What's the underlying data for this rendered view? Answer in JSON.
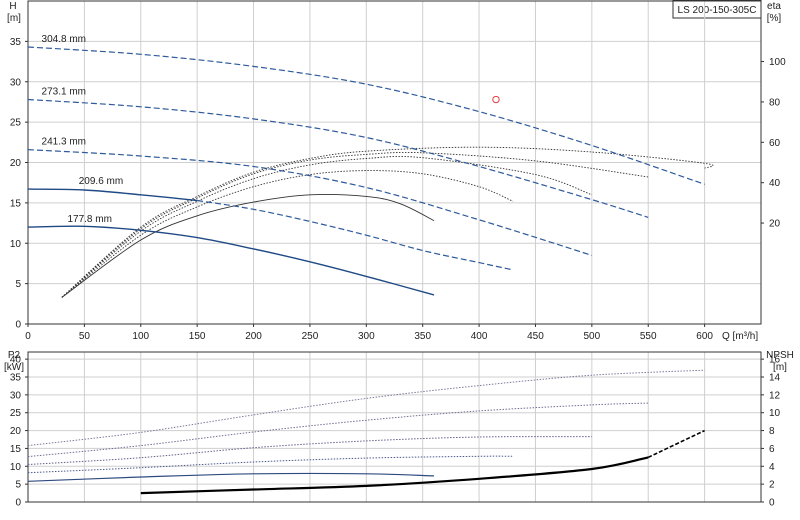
{
  "title_box": "LS 200-150-305C",
  "colors": {
    "head_curve": "#2e5a9c",
    "head_solid": "#1f4a85",
    "eta_curve": "#333333",
    "npsh_curve": "#000000",
    "duty_point": "#e0403f",
    "grid": "#cfcfcf"
  },
  "chart_data": [
    {
      "type": "line",
      "panel": "head",
      "xlabel": "Q [m³/h]",
      "ylabel_left": "H\n[m]",
      "ylabel_right": "eta\n[%]",
      "xlim": [
        0,
        650
      ],
      "ylim": [
        0,
        40
      ],
      "ylim_right": [
        -30,
        130
      ],
      "x_ticks": [
        0,
        50,
        100,
        150,
        200,
        250,
        300,
        350,
        400,
        450,
        500,
        550,
        600
      ],
      "y_ticks": [
        0,
        5,
        10,
        15,
        20,
        25,
        30,
        35
      ],
      "y_ticks_right": [
        20,
        40,
        60,
        80,
        100
      ],
      "grid": true,
      "head_series": [
        {
          "name": "304.8 mm",
          "style": "dashed",
          "points": [
            [
              0,
              34.3
            ],
            [
              100,
              33.4
            ],
            [
              200,
              31.9
            ],
            [
              300,
              29.7
            ],
            [
              400,
              26.3
            ],
            [
              500,
              22.1
            ],
            [
              600,
              17.3
            ]
          ]
        },
        {
          "name": "273.1 mm",
          "style": "dashed",
          "points": [
            [
              0,
              27.8
            ],
            [
              100,
              26.9
            ],
            [
              200,
              25.4
            ],
            [
              300,
              23.1
            ],
            [
              400,
              19.5
            ],
            [
              500,
              15.4
            ],
            [
              550,
              13.2
            ]
          ]
        },
        {
          "name": "241.3 mm",
          "style": "dashed",
          "points": [
            [
              0,
              21.6
            ],
            [
              100,
              20.8
            ],
            [
              200,
              19.5
            ],
            [
              300,
              16.9
            ],
            [
              400,
              12.9
            ],
            [
              500,
              8.5
            ]
          ]
        },
        {
          "name": "209.6 mm",
          "style": "mixed",
          "points": [
            [
              0,
              16.7
            ],
            [
              50,
              16.6
            ],
            [
              100,
              16.0
            ],
            [
              150,
              15.3
            ],
            [
              200,
              14.2
            ],
            [
              250,
              12.7
            ],
            [
              300,
              11.0
            ],
            [
              350,
              9.1
            ],
            [
              400,
              7.6
            ],
            [
              430,
              6.7
            ]
          ]
        },
        {
          "name": "177.8 mm",
          "style": "solid",
          "points": [
            [
              0,
              12.0
            ],
            [
              50,
              12.1
            ],
            [
              100,
              11.6
            ],
            [
              150,
              10.7
            ],
            [
              200,
              9.3
            ],
            [
              250,
              7.7
            ],
            [
              300,
              5.9
            ],
            [
              360,
              3.6
            ]
          ]
        }
      ],
      "eta_series": [
        {
          "style": "dotted",
          "points": [
            [
              30,
              3.3
            ],
            [
              100,
              12.0
            ],
            [
              150,
              15.8
            ],
            [
              200,
              18.8
            ],
            [
              250,
              20.5
            ],
            [
              300,
              21.4
            ],
            [
              400,
              21.9
            ],
            [
              500,
              21.3
            ],
            [
              600,
              19.9
            ],
            [
              600,
              19.3
            ]
          ]
        },
        {
          "style": "dotted",
          "points": [
            [
              30,
              3.3
            ],
            [
              100,
              11.8
            ],
            [
              150,
              15.6
            ],
            [
              200,
              18.6
            ],
            [
              250,
              20.3
            ],
            [
              300,
              21.0
            ],
            [
              350,
              21.2
            ],
            [
              450,
              20.2
            ],
            [
              550,
              18.2
            ]
          ]
        },
        {
          "style": "dotted",
          "points": [
            [
              30,
              3.3
            ],
            [
              100,
              11.5
            ],
            [
              150,
              15.2
            ],
            [
              200,
              18.0
            ],
            [
              250,
              19.7
            ],
            [
              300,
              20.5
            ],
            [
              350,
              20.6
            ],
            [
              450,
              18.5
            ],
            [
              500,
              16.0
            ]
          ]
        },
        {
          "style": "dotted",
          "points": [
            [
              30,
              3.3
            ],
            [
              100,
              11.0
            ],
            [
              150,
              14.5
            ],
            [
              200,
              17.0
            ],
            [
              250,
              18.5
            ],
            [
              300,
              19.0
            ],
            [
              350,
              18.6
            ],
            [
              400,
              17.0
            ],
            [
              430,
              15.2
            ]
          ]
        },
        {
          "style": "solid",
          "points": [
            [
              30,
              3.3
            ],
            [
              100,
              10.4
            ],
            [
              150,
              13.4
            ],
            [
              200,
              15.1
            ],
            [
              250,
              16.0
            ],
            [
              300,
              15.8
            ],
            [
              330,
              14.9
            ],
            [
              360,
              12.8
            ]
          ]
        }
      ],
      "duty_point": {
        "q": 415,
        "h": 27.8
      }
    },
    {
      "type": "line",
      "panel": "power",
      "xlim": [
        0,
        650
      ],
      "ylabel_left": "P2\n[kW]",
      "ylabel_right": "NPSH\n[m]",
      "ylim": [
        0,
        42
      ],
      "ylim_right": [
        0,
        16.8
      ],
      "y_ticks": [
        0,
        5,
        10,
        15,
        20,
        25,
        30,
        35,
        40
      ],
      "y_ticks_right": [
        0,
        2,
        4,
        6,
        8,
        10,
        12,
        14,
        16
      ],
      "grid": true,
      "power_series": [
        {
          "style": "dotted",
          "points": [
            [
              0,
              15.8
            ],
            [
              100,
              19.5
            ],
            [
              200,
              24.4
            ],
            [
              300,
              29.0
            ],
            [
              400,
              32.6
            ],
            [
              500,
              35.5
            ],
            [
              600,
              36.9
            ]
          ]
        },
        {
          "style": "dotted",
          "points": [
            [
              0,
              12.7
            ],
            [
              100,
              15.8
            ],
            [
              200,
              19.6
            ],
            [
              300,
              22.9
            ],
            [
              400,
              25.5
            ],
            [
              500,
              27.2
            ],
            [
              550,
              27.7
            ]
          ]
        },
        {
          "style": "dotted",
          "points": [
            [
              0,
              10.5
            ],
            [
              100,
              12.4
            ],
            [
              200,
              15.2
            ],
            [
              300,
              17.1
            ],
            [
              400,
              18.2
            ],
            [
              500,
              18.3
            ]
          ]
        },
        {
          "style": "dotted",
          "points": [
            [
              0,
              8.2
            ],
            [
              100,
              9.6
            ],
            [
              200,
              11.2
            ],
            [
              300,
              12.3
            ],
            [
              400,
              12.8
            ],
            [
              430,
              12.8
            ]
          ]
        },
        {
          "style": "solid",
          "points": [
            [
              0,
              5.8
            ],
            [
              100,
              7.0
            ],
            [
              200,
              7.9
            ],
            [
              300,
              7.9
            ],
            [
              360,
              7.3
            ]
          ]
        }
      ],
      "npsh_series": [
        {
          "style": "solid",
          "points": [
            [
              100,
              1.0
            ],
            [
              200,
              1.4
            ],
            [
              300,
              1.8
            ],
            [
              400,
              2.6
            ],
            [
              500,
              3.7
            ],
            [
              550,
              5.0
            ]
          ]
        },
        {
          "style": "dashed",
          "points": [
            [
              550,
              5.0
            ],
            [
              600,
              8.0
            ]
          ]
        }
      ]
    }
  ],
  "legend": [
    {
      "label": "304.8 mm"
    },
    {
      "label": "273.1 mm"
    },
    {
      "label": "241.3 mm"
    },
    {
      "label": "209.6 mm"
    },
    {
      "label": "177.8 mm"
    }
  ]
}
